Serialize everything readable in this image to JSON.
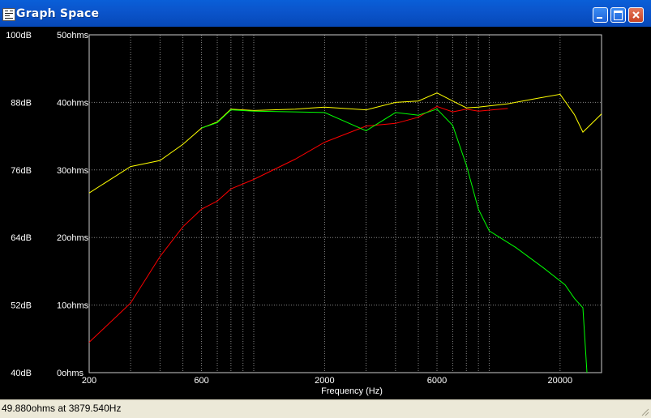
{
  "window": {
    "title": "Graph Space",
    "minimize_icon": "minimize-icon",
    "maximize_icon": "maximize-icon",
    "close_icon": "close-icon",
    "app_icon": "graph-app-icon"
  },
  "status": {
    "text": "49.880ohms at 3879.540Hz"
  },
  "colors": {
    "background": "#000000",
    "grid": "#888888",
    "spl_series": "#ff0000",
    "impedance_series": "#ffff00",
    "green_series": "#00ff00"
  },
  "chart_data": {
    "type": "line",
    "title": "",
    "xlabel": "Frequency (Hz)",
    "x_scale": "log",
    "xlim": [
      200,
      30000
    ],
    "x_ticks": [
      {
        "value": 200,
        "label": "200"
      },
      {
        "value": 600,
        "label": "600"
      },
      {
        "value": 2000,
        "label": "2000"
      },
      {
        "value": 6000,
        "label": "6000"
      },
      {
        "value": 20000,
        "label": "20000"
      }
    ],
    "ylim_db": [
      40,
      100
    ],
    "y_ticks_db": [
      "40dB",
      "52dB",
      "64dB",
      "76dB",
      "88dB",
      "100dB"
    ],
    "ylim_ohms": [
      0,
      50
    ],
    "y_ticks_ohms": [
      "0ohms",
      "10ohms",
      "20ohms",
      "30ohms",
      "40ohms",
      "50ohms"
    ],
    "grid": true,
    "series": [
      {
        "axis": "ohms",
        "color": "#ffff00",
        "points": [
          [
            200,
            26.6
          ],
          [
            300,
            30.5
          ],
          [
            400,
            31.4
          ],
          [
            500,
            33.8
          ],
          [
            600,
            36.2
          ],
          [
            700,
            37.1
          ],
          [
            800,
            39.0
          ],
          [
            1000,
            38.8
          ],
          [
            1500,
            39.0
          ],
          [
            2000,
            39.3
          ],
          [
            3000,
            38.9
          ],
          [
            4000,
            40.0
          ],
          [
            5000,
            40.2
          ],
          [
            6000,
            41.4
          ],
          [
            7000,
            40.2
          ],
          [
            8000,
            39.2
          ],
          [
            9000,
            39.3
          ],
          [
            12000,
            39.8
          ],
          [
            16000,
            40.6
          ],
          [
            20000,
            41.2
          ],
          [
            23000,
            38.2
          ],
          [
            25000,
            35.6
          ],
          [
            30000,
            38.3
          ]
        ]
      },
      {
        "axis": "ohms",
        "color": "#ff0000",
        "points": [
          [
            200,
            4.5
          ],
          [
            300,
            10.3
          ],
          [
            400,
            17.2
          ],
          [
            500,
            21.6
          ],
          [
            600,
            24.2
          ],
          [
            700,
            25.4
          ],
          [
            800,
            27.2
          ],
          [
            1000,
            28.6
          ],
          [
            1500,
            31.6
          ],
          [
            2000,
            34.1
          ],
          [
            3000,
            36.5
          ],
          [
            4000,
            36.9
          ],
          [
            5000,
            37.8
          ],
          [
            6000,
            39.4
          ],
          [
            7000,
            38.6
          ],
          [
            8000,
            39.0
          ],
          [
            9000,
            38.7
          ],
          [
            12000,
            39.1
          ]
        ]
      },
      {
        "axis": "ohms",
        "color": "#00ff00",
        "points": [
          [
            600,
            36.2
          ],
          [
            700,
            37.0
          ],
          [
            800,
            38.9
          ],
          [
            1000,
            38.7
          ],
          [
            1500,
            38.6
          ],
          [
            2000,
            38.5
          ],
          [
            3000,
            35.8
          ],
          [
            4000,
            38.5
          ],
          [
            5000,
            38.1
          ],
          [
            6000,
            39.0
          ],
          [
            7000,
            36.6
          ],
          [
            8000,
            30.7
          ],
          [
            9000,
            24.2
          ],
          [
            10000,
            21.0
          ],
          [
            13000,
            18.5
          ],
          [
            17000,
            15.5
          ],
          [
            21000,
            13.0
          ],
          [
            23000,
            11.0
          ],
          [
            25000,
            9.6
          ],
          [
            26000,
            0.0
          ]
        ]
      }
    ]
  }
}
